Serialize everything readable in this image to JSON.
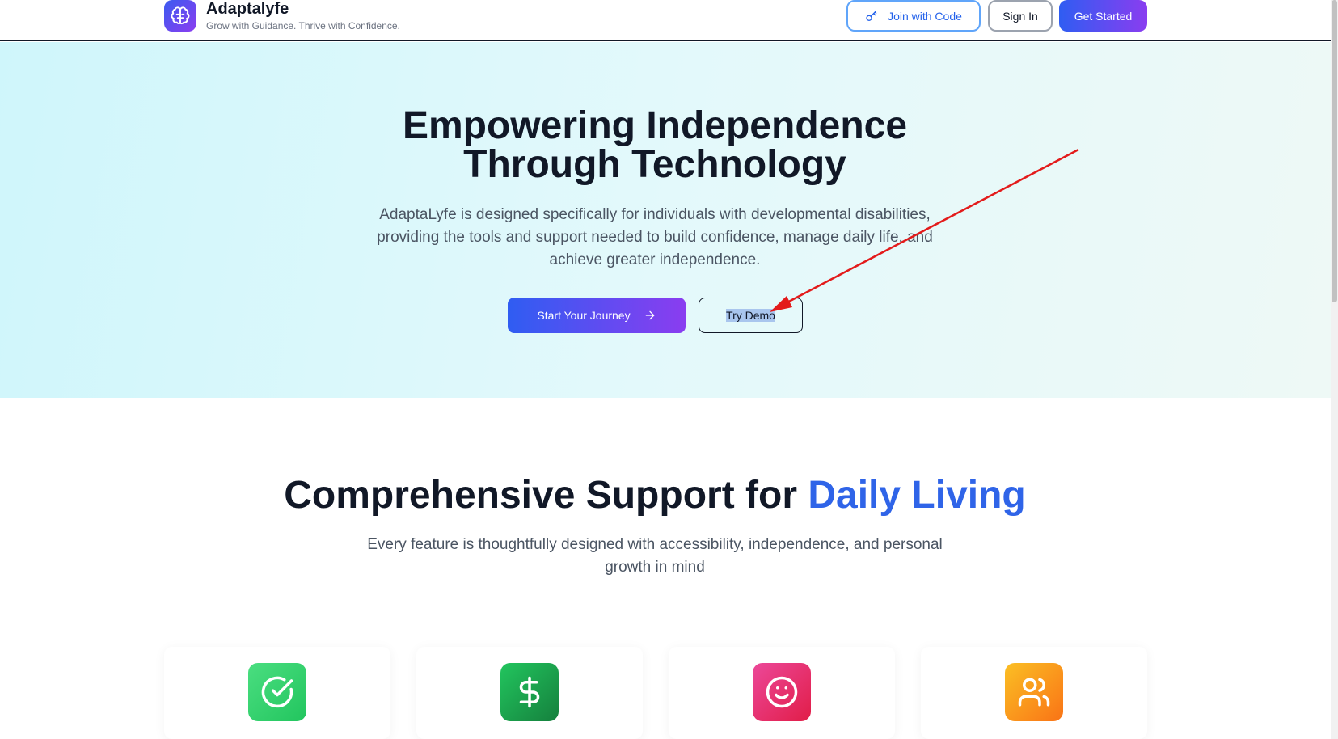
{
  "brand": {
    "name": "Adaptalyfe",
    "tagline": "Grow with Guidance. Thrive with Confidence."
  },
  "nav": {
    "join_label": "Join with Code",
    "signin_label": "Sign In",
    "get_started_label": "Get Started"
  },
  "hero": {
    "title_line1": "Empowering Independence",
    "title_line2": "Through Technology",
    "description": "AdaptaLyfe is designed specifically for individuals with developmental disabilities, providing the tools and support needed to build confidence, manage daily life, and achieve greater independence.",
    "start_label": "Start Your Journey",
    "demo_label": "Try Demo"
  },
  "features": {
    "title_main": "Comprehensive Support for ",
    "title_accent": "Daily Living",
    "description": "Every feature is thoughtfully designed with accessibility, independence, and personal growth in mind",
    "cards": [
      {
        "icon": "check-circle-icon",
        "color": "#22c55e"
      },
      {
        "icon": "dollar-icon",
        "color": "#16a34a"
      },
      {
        "icon": "smile-icon",
        "color": "#e11d74"
      },
      {
        "icon": "users-icon",
        "color": "#f59e0b"
      }
    ]
  },
  "colors": {
    "accent": "#2f64e8",
    "gradient_start": "#2f5df2",
    "gradient_end": "#8a3df0",
    "annotation_arrow": "#e31b1b"
  }
}
